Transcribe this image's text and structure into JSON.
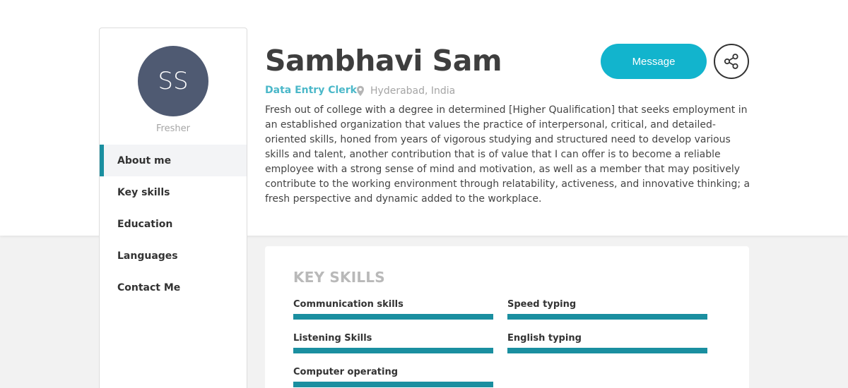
{
  "profile": {
    "initials": "SS",
    "status": "Fresher",
    "name": "Sambhavi Sam",
    "job_title": "Data Entry Clerk.",
    "location": "Hyderabad, India",
    "location_icon": "map-pin-icon",
    "about": "Fresh out of college with a degree in determined [Higher Qualification] that seeks employment in an established organization that values the practice of interpersonal, critical, and detailed-oriented skills, honed from years of vigorous studying and structured need to develop various skills and talent, another contribution that is of value that I can offer is to become a reliable employee with a strong sense of mind and motivation, as well as a member that may positively contribute to the working environment through relatability, activeness, and innovative thinking; a fresh perspective and dynamic added to the workplace."
  },
  "actions": {
    "message_label": "Message",
    "share_icon": "share-icon"
  },
  "nav": {
    "items": [
      {
        "label": "About me",
        "active": true
      },
      {
        "label": "Key skills",
        "active": false
      },
      {
        "label": "Education",
        "active": false
      },
      {
        "label": "Languages",
        "active": false
      },
      {
        "label": "Contact Me",
        "active": false
      }
    ]
  },
  "skills": {
    "title": "KEY SKILLS",
    "items": [
      {
        "label": "Communication skills",
        "level": 1.0
      },
      {
        "label": "Speed typing",
        "level": 1.0
      },
      {
        "label": "Listening Skills",
        "level": 1.0
      },
      {
        "label": "English typing",
        "level": 1.0
      },
      {
        "label": "Computer operating",
        "level": 1.0
      }
    ]
  },
  "colors": {
    "accent": "#12b4cd",
    "skill_bar": "#1a8fa0",
    "avatar_bg": "#4f5a72",
    "job_title": "#4bb8c9"
  }
}
